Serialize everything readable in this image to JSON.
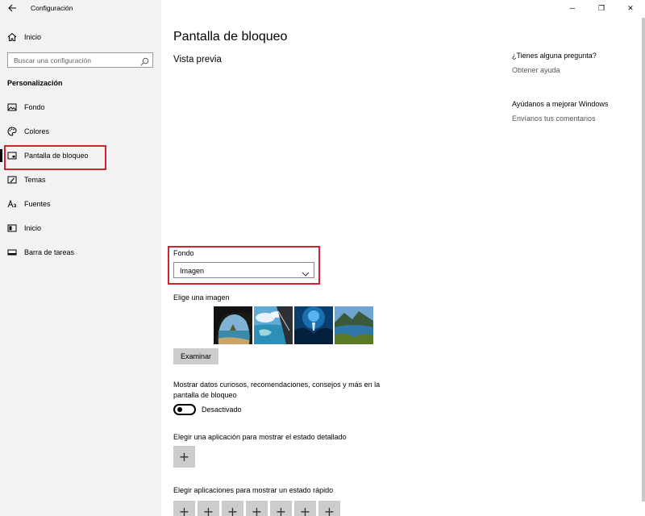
{
  "window": {
    "app_title": "Configuración",
    "controls": {
      "minimize": "─",
      "restore": "❐",
      "close": "✕"
    }
  },
  "sidebar": {
    "home_label": "Inicio",
    "search_placeholder": "Buscar una configuración",
    "section_title": "Personalización",
    "items": [
      {
        "label": "Fondo",
        "icon": "image-icon"
      },
      {
        "label": "Colores",
        "icon": "palette-icon"
      },
      {
        "label": "Pantalla de bloqueo",
        "icon": "lock-screen-icon",
        "selected": true
      },
      {
        "label": "Temas",
        "icon": "brush-icon"
      },
      {
        "label": "Fuentes",
        "icon": "font-icon"
      },
      {
        "label": "Inicio",
        "icon": "start-icon"
      },
      {
        "label": "Barra de tareas",
        "icon": "taskbar-icon"
      }
    ]
  },
  "main": {
    "page_title": "Pantalla de bloqueo",
    "preview_label": "Vista previa",
    "background_label": "Fondo",
    "background_value": "Imagen",
    "choose_image_label": "Elige una imagen",
    "browse_button": "Examinar",
    "fun_facts_text": "Mostrar datos curiosos, recomendaciones, consejos y más en la pantalla de bloqueo",
    "fun_facts_toggle": {
      "state": "off",
      "label": "Desactivado"
    },
    "detail_app_label": "Elegir una aplicación para mostrar el estado detallado",
    "quick_apps_label": "Elegir aplicaciones para mostrar un estado rápido",
    "plus_symbol": "+"
  },
  "related": {
    "question": "¿Tienes alguna pregunta?",
    "help_link": "Obtener ayuda",
    "improve_title": "Ayúdanos a mejorar Windows",
    "feedback_link": "Envíanos tus comentarios"
  },
  "colors": {
    "highlight": "#d0232c",
    "sidebar_bg": "#f2f2f2",
    "button_bg": "#cccccc"
  }
}
